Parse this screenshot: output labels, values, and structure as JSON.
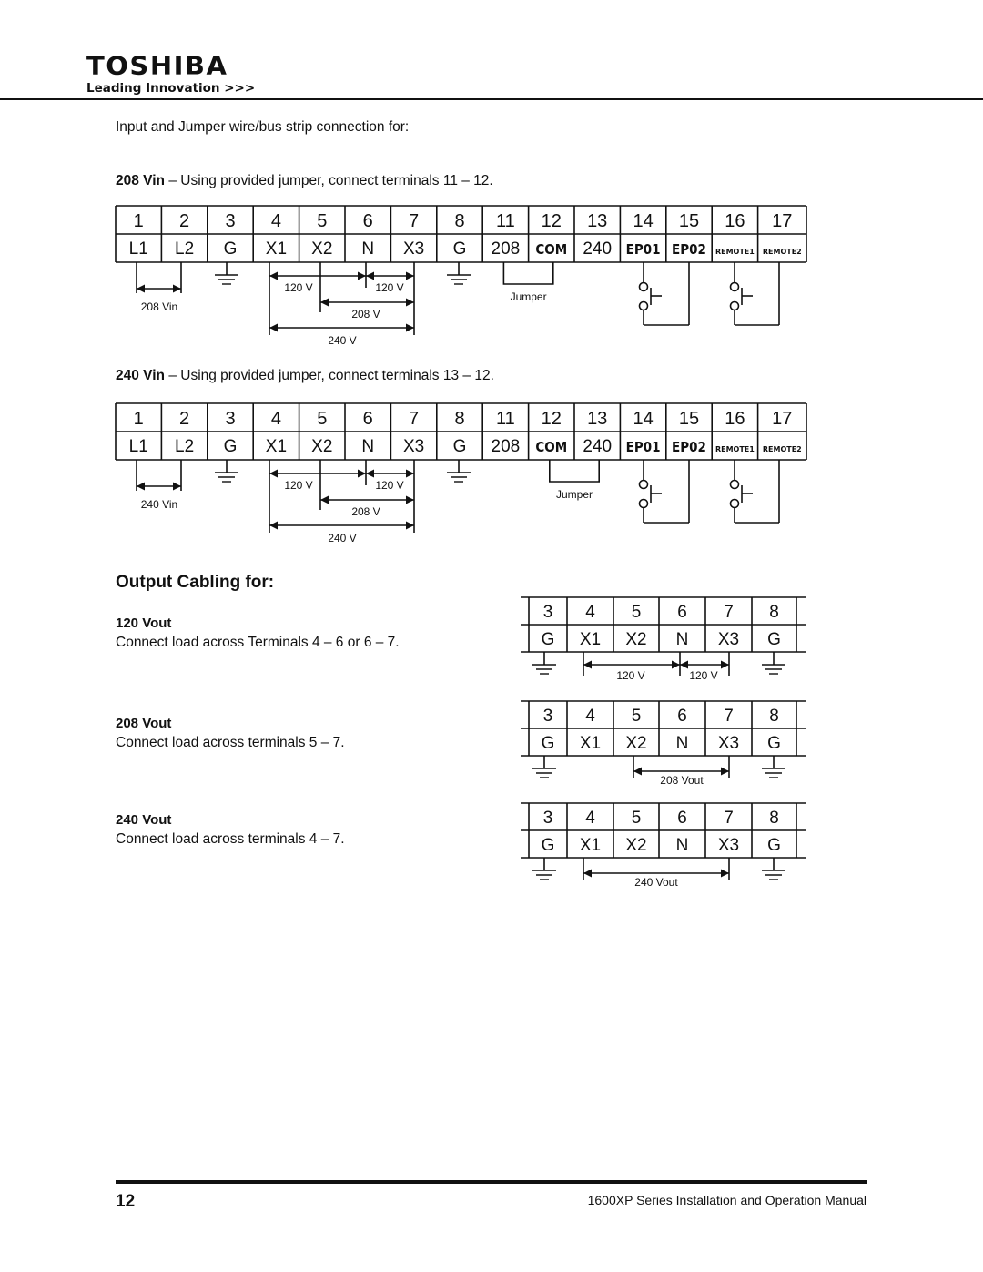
{
  "header": {
    "brand": "TOSHIBA",
    "tagline": "Leading Innovation >>>"
  },
  "intro": "Input and Jumper wire/bus strip connection for:",
  "input_sections": [
    {
      "title_bold": "208 Vin",
      "title_rest": " – Using provided jumper, connect terminals 11 – 12.",
      "vin_label": "208 Vin",
      "jumper_terminals": [
        11,
        12
      ],
      "jumper_label": "Jumper"
    },
    {
      "title_bold": "240 Vin",
      "title_rest": " – Using provided jumper, connect terminals 13 – 12.",
      "vin_label": "240 Vin",
      "jumper_terminals": [
        12,
        13
      ],
      "jumper_label": "Jumper"
    }
  ],
  "input_strip": {
    "numbers": [
      "1",
      "2",
      "3",
      "4",
      "5",
      "6",
      "7",
      "8",
      "11",
      "12",
      "13",
      "14",
      "15",
      "16",
      "17"
    ],
    "labels": [
      "L1",
      "L2",
      "G",
      "X1",
      "X2",
      "N",
      "X3",
      "G",
      "208",
      "COM",
      "240",
      "EP01",
      "EP02",
      "REMOTE1",
      "REMOTE2"
    ],
    "voltage_labels": {
      "x1_n": "120 V",
      "n_x3": "120 V",
      "x2_x3": "208 V",
      "x1_x3": "240 V"
    }
  },
  "output": {
    "heading": "Output Cabling for:",
    "strip_numbers": [
      "3",
      "4",
      "5",
      "6",
      "7",
      "8"
    ],
    "strip_labels": [
      "G",
      "X1",
      "X2",
      "N",
      "X3",
      "G"
    ],
    "sections": [
      {
        "title": "120 Vout",
        "text": "Connect load across Terminals 4 – 6 or 6 – 7.",
        "labels": [
          "120 V",
          "120 V"
        ]
      },
      {
        "title": "208 Vout",
        "text": "Connect load across terminals 5  –  7.",
        "labels": [
          "208 Vout"
        ]
      },
      {
        "title": "240 Vout",
        "text": "Connect load across terminals 4  –  7.",
        "labels": [
          "240 Vout"
        ]
      }
    ]
  },
  "footer": {
    "page_number": "12",
    "manual_title": "1600XP Series Installation and Operation Manual"
  }
}
